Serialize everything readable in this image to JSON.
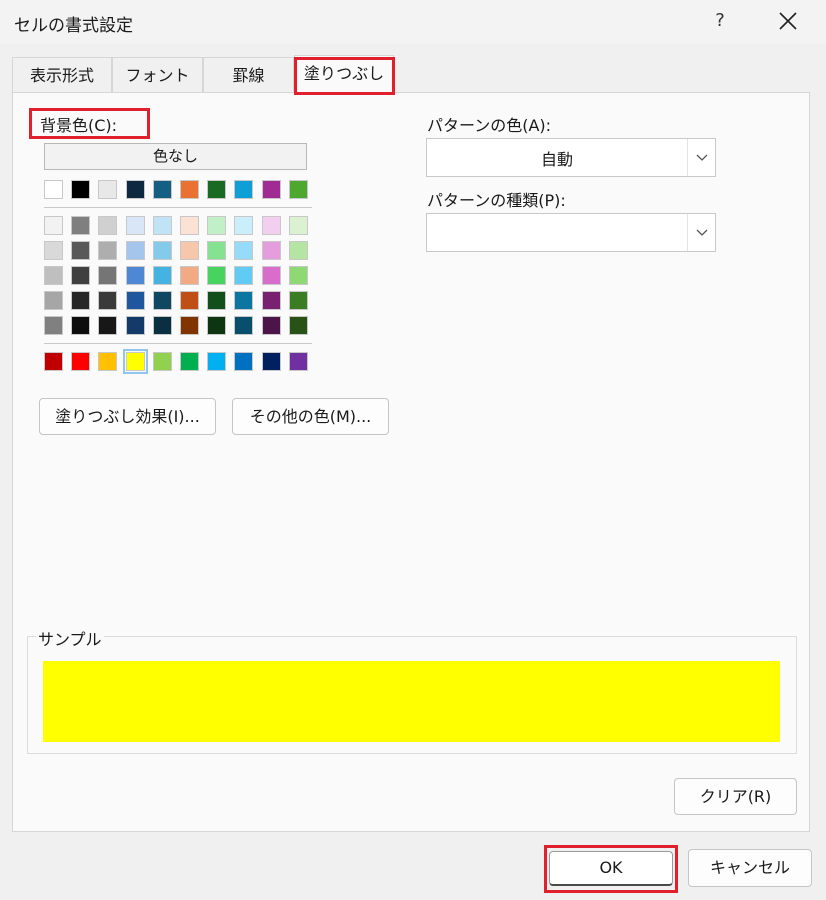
{
  "window": {
    "title": "セルの書式設定",
    "help_label": "?"
  },
  "tabs": [
    {
      "label": "表示形式"
    },
    {
      "label": "フォント"
    },
    {
      "label": "罫線"
    },
    {
      "label": "塗りつぶし"
    }
  ],
  "background_color": {
    "label": "背景色(C):",
    "no_color_label": "色なし",
    "selected_color": "#ffff00",
    "theme_row": [
      "#ffffff",
      "#000000",
      "#e8e8e8",
      "#0e2841",
      "#156082",
      "#e97132",
      "#196b24",
      "#0f9ed5",
      "#a02b93",
      "#4ea72e"
    ],
    "tint_rows": [
      [
        "#f2f2f2",
        "#7f7f7f",
        "#d0d0d0",
        "#d9e6f7",
        "#c0e4f5",
        "#fbe2d5",
        "#c1f0c8",
        "#cbeefb",
        "#f2cfee",
        "#daf2d0"
      ],
      [
        "#d9d9d9",
        "#595959",
        "#aeaeae",
        "#a5c6ec",
        "#83caeb",
        "#f7c7ac",
        "#84e291",
        "#96dcf8",
        "#e59edd",
        "#b4e5a2"
      ],
      [
        "#bfbfbf",
        "#404040",
        "#757575",
        "#4e88d4",
        "#44b3e1",
        "#f2aa84",
        "#47d45e",
        "#61cbf4",
        "#d86dcb",
        "#8ed973"
      ],
      [
        "#a6a6a6",
        "#262626",
        "#3a3a3a",
        "#1f579e",
        "#0f4761",
        "#c04f15",
        "#124f1a",
        "#0b76a0",
        "#782170",
        "#3b7d23"
      ],
      [
        "#808080",
        "#0d0d0d",
        "#171717",
        "#143a69",
        "#0a2f40",
        "#803501",
        "#0d3512",
        "#074f6a",
        "#4c1448",
        "#275317"
      ]
    ],
    "standard_row": [
      "#c00000",
      "#ff0000",
      "#ffc000",
      "#ffff00",
      "#92d050",
      "#00b050",
      "#00b0f0",
      "#0070c0",
      "#002060",
      "#7030a0"
    ]
  },
  "fill_effects_label": "塗りつぶし効果(I)...",
  "more_colors_label": "その他の色(M)...",
  "pattern_color": {
    "label": "パターンの色(A):",
    "value": "自動"
  },
  "pattern_style": {
    "label": "パターンの種類(P):",
    "value": ""
  },
  "sample": {
    "label": "サンプル",
    "color": "#ffff00"
  },
  "clear_label": "クリア(R)",
  "ok_label": "OK",
  "cancel_label": "キャンセル",
  "highlight_color": "#e0202c"
}
